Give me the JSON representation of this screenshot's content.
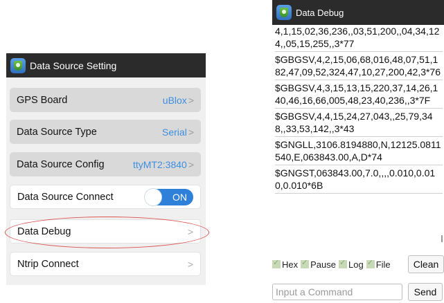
{
  "left": {
    "title": "Data Source Setting",
    "icon": "app-shield-icon",
    "rows": [
      {
        "label": "GPS Board",
        "value": "uBlox",
        "chevron": ">"
      },
      {
        "label": "Data Source Type",
        "value": "Serial",
        "chevron": ">"
      },
      {
        "label": "Data Source Config",
        "value": "ttyMT2:3840",
        "chevron": ">"
      },
      {
        "label": "Data Source Connect",
        "toggle": "ON"
      },
      {
        "label": "Data Debug",
        "chevron": ">"
      },
      {
        "label": "Ntrip Connect",
        "chevron": ">"
      }
    ],
    "highlight_color": "#d9534f"
  },
  "right": {
    "title": "Data Debug",
    "log": [
      "4,1,15,02,36,236,,03,51,200,,04,34,124,,05,15,255,,3*77",
      "$GBGSV,4,2,15,06,68,016,48,07,51,182,47,09,52,324,47,10,27,200,42,3*76",
      "$GBGSV,4,3,15,13,15,220,37,14,26,140,46,16,66,005,48,23,40,236,,3*7F",
      "$GBGSV,4,4,15,24,27,043,,25,79,348,,33,53,142,,3*43",
      "$GNGLL,3106.8194880,N,12125.0811540,E,063843.00,A,D*74",
      "$GNGST,063843.00,7.0,,,,0.010,0.010,0.010*6B"
    ],
    "checkboxes": [
      "Hex",
      "Pause",
      "Log",
      "File"
    ],
    "clean_label": "Clean",
    "command_placeholder": "Input a Command",
    "send_label": "Send"
  },
  "colors": {
    "titlebar": "#2b2b2b",
    "accent_value": "#3d8fe0",
    "toggle_on": "#2f80d8"
  }
}
